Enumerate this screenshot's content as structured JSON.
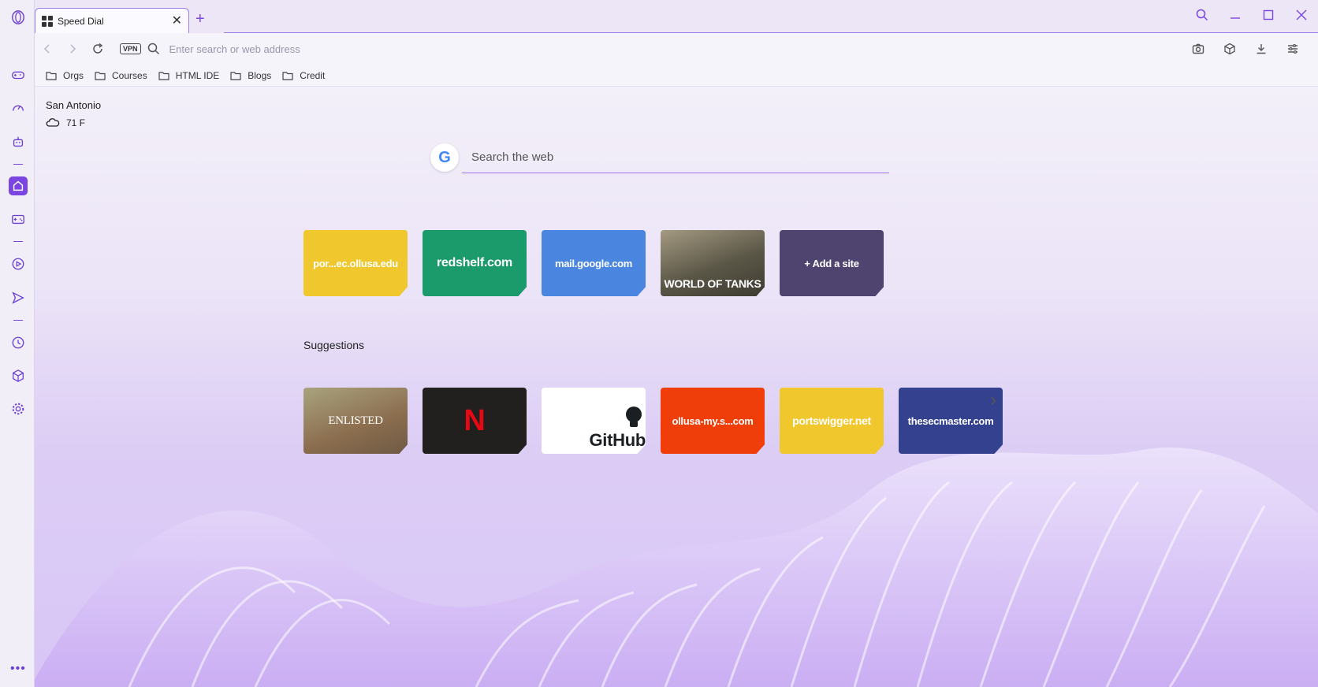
{
  "tab": {
    "title": "Speed Dial"
  },
  "toolbar": {
    "vpn_label": "VPN",
    "address_placeholder": "Enter search or web address"
  },
  "bookmarks": [
    "Orgs",
    "Courses",
    "HTML IDE",
    "Blogs",
    "Credit"
  ],
  "weather": {
    "city": "San Antonio",
    "temp": "71 F"
  },
  "search": {
    "placeholder": "Search the web",
    "logo": "G"
  },
  "speed_dial": [
    {
      "label": "por...ec.ollusa.edu",
      "color": "#f0c72d"
    },
    {
      "label": "redshelf.com",
      "color": "#1b9a6c"
    },
    {
      "label": "mail.google.com",
      "color": "#4a86e0"
    },
    {
      "label": "WORLD OF TANKS",
      "color": "#5d5a4e"
    },
    {
      "label": "+ Add a site",
      "color": "#4f4470"
    }
  ],
  "suggestions_title": "Suggestions",
  "suggestions": [
    {
      "label": "ENLISTED",
      "color": "#8a7d66"
    },
    {
      "label": "N",
      "color": "#221f1f"
    },
    {
      "label": "GitHub",
      "color": "#ffffff"
    },
    {
      "label": "ollusa-my.s...com",
      "color": "#f03e0a"
    },
    {
      "label": "portswigger.net",
      "color": "#f0c72d"
    },
    {
      "label": "thesecmaster.com",
      "color": "#34418f"
    }
  ]
}
